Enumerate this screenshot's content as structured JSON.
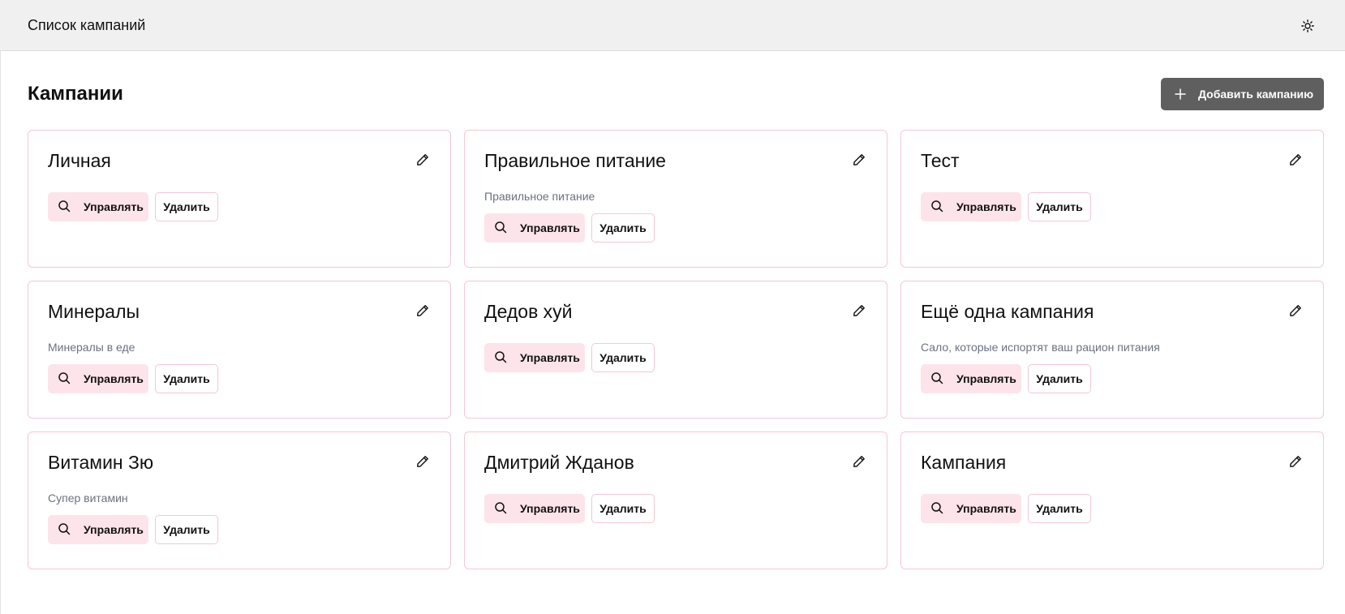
{
  "header": {
    "title": "Список кампаний",
    "theme_icon": "sun-icon"
  },
  "main": {
    "heading": "Кампании",
    "add_button_label": "Добавить кампанию",
    "add_icon": "plus-icon"
  },
  "card_actions": {
    "manage_label": "Управлять",
    "delete_label": "Удалить",
    "manage_icon": "search-icon",
    "edit_icon": "pencil-icon"
  },
  "campaigns": [
    {
      "title": "Личная",
      "description": ""
    },
    {
      "title": "Правильное питание",
      "description": "Правильное питание"
    },
    {
      "title": "Тест",
      "description": ""
    },
    {
      "title": "Минералы",
      "description": "Минералы в еде"
    },
    {
      "title": "Дедов хуй",
      "description": ""
    },
    {
      "title": "Ещё одна кампания",
      "description": "Сало, которые испортят ваш рацион питания"
    },
    {
      "title": "Витамин Зю",
      "description": "Супер витамин"
    },
    {
      "title": "Дмитрий Жданов",
      "description": ""
    },
    {
      "title": "Кампания",
      "description": ""
    }
  ],
  "colors": {
    "card_border": "#f6c7d2",
    "manage_bg": "#fde4ea",
    "add_button_bg": "#5f5f5f",
    "header_bg": "#f0f0f0",
    "description_text": "#6b7280"
  }
}
